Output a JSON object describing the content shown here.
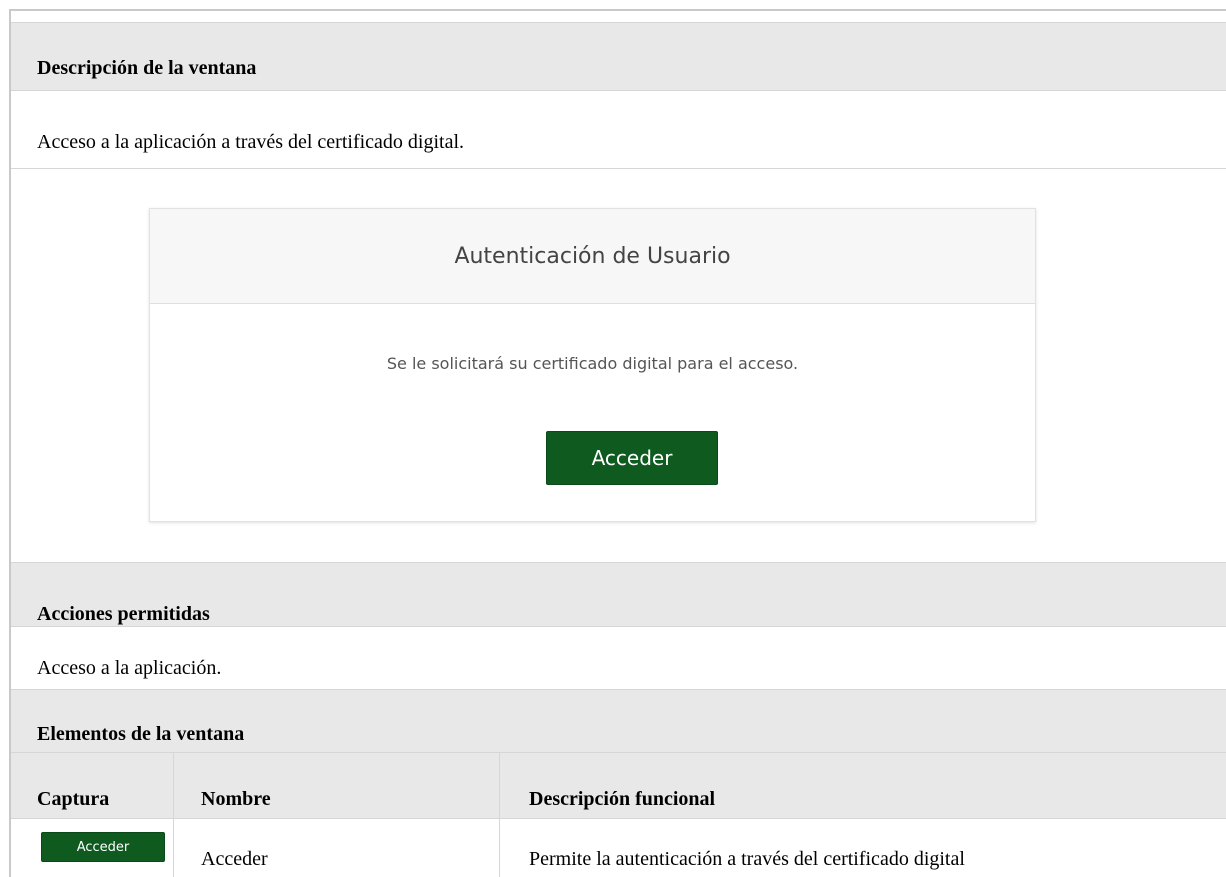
{
  "sections": {
    "description_title": "Descripción de la ventana",
    "description_text": "Acceso a la aplicación a través del certificado digital.",
    "actions_title": "Acciones permitidas",
    "actions_text": "Acceso a la aplicación.",
    "elements_title": "Elementos de la ventana"
  },
  "login_panel": {
    "title": "Autenticación de Usuario",
    "message": "Se le solicitará su certificado digital para el acceso.",
    "button_label": "Acceder",
    "button_color": "#0e5a1f"
  },
  "elements_table": {
    "headers": [
      "Captura",
      "Nombre",
      "Descripción funcional"
    ],
    "rows": [
      {
        "capture_label": "Acceder",
        "name": "Acceder",
        "description": "Permite la autenticación a través del certificado digital"
      }
    ]
  }
}
